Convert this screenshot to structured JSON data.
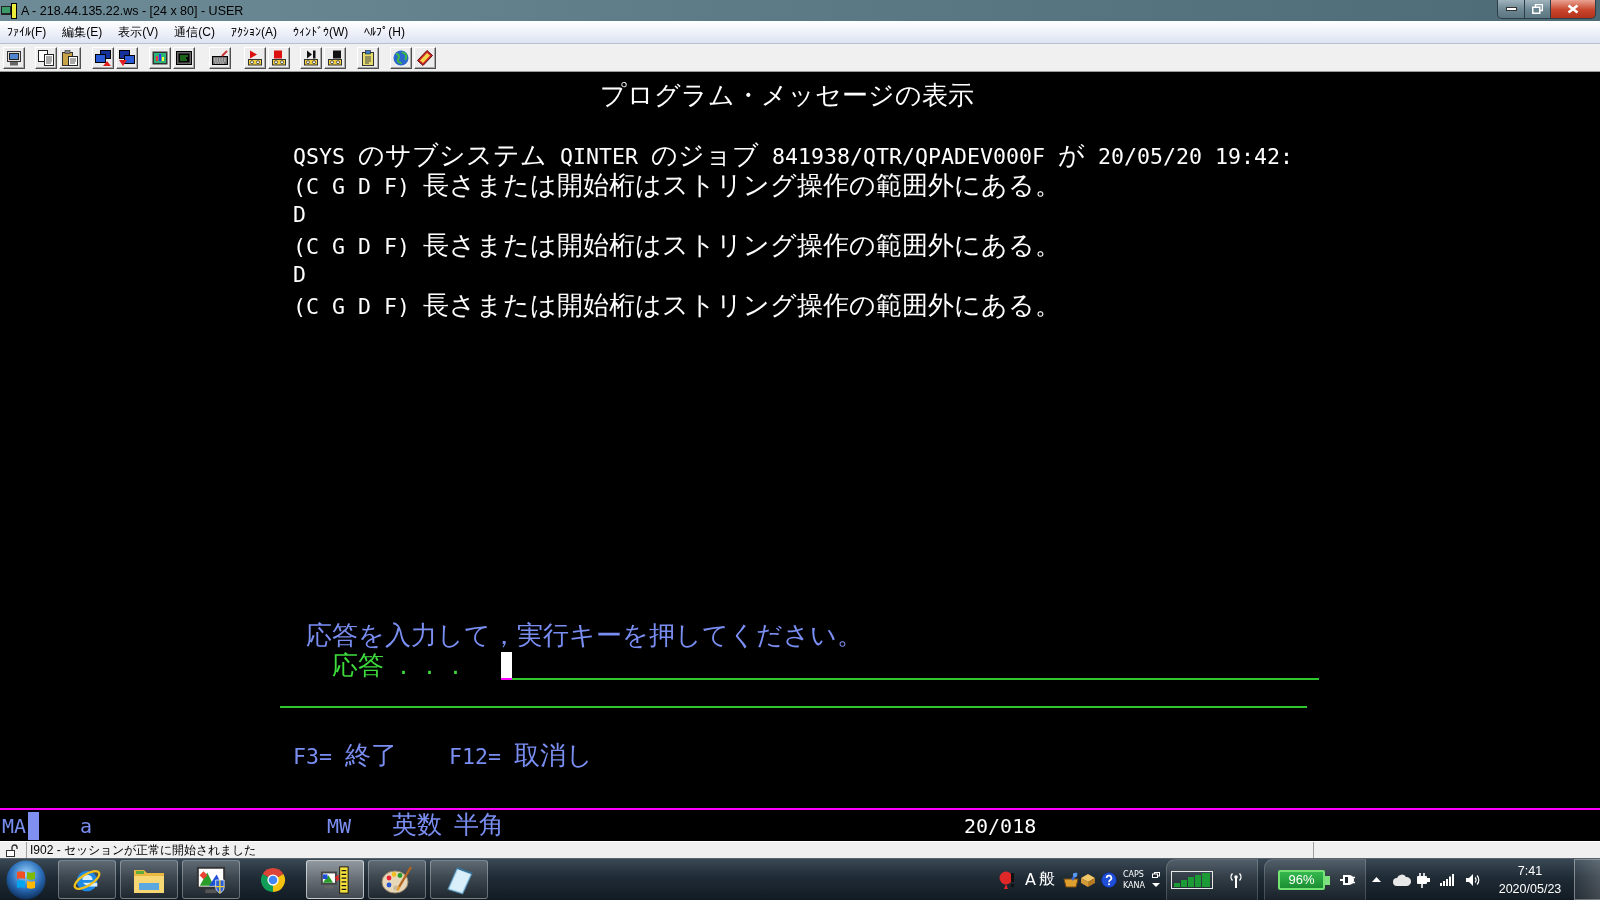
{
  "window": {
    "title": "A - 218.44.135.22.ws - [24 x 80] - USER"
  },
  "menu": [
    "ﾌｧｲﾙ(F)",
    "編集(E)",
    "表示(V)",
    "通信(C)",
    "ｱｸｼｮﾝ(A)",
    "ｳｨﾝﾄﾞｳ(W)",
    "ﾍﾙﾌﾟ(H)"
  ],
  "terminal": {
    "title": "プログラム・メッセージの表示",
    "message_lines": [
      "QSYS のサブシステム QINTER のジョブ 841938/QTR/QPADEV000F が 20/05/20 19:42:",
      "(C G D F) 長さまたは開始桁はストリング操作の範囲外にある。",
      "D",
      "(C G D F) 長さまたは開始桁はストリング操作の範囲外にある。",
      "D",
      "(C G D F) 長さまたは開始桁はストリング操作の範囲外にある。"
    ],
    "instruction": "応答を入力して，実行キーを押してください。",
    "reply_label": "応答 . . .",
    "function_keys": [
      "F3= 終了",
      "F12= 取消し"
    ]
  },
  "oia": {
    "status": "MA",
    "input_mode": "a",
    "field_mode": "MW",
    "ime_mode": "英数 半角",
    "cursor_position": "20/018"
  },
  "status_bar": {
    "message": "I902 - セッションが正常に開始されました"
  },
  "taskbar": {
    "apps": [
      {
        "kind": "orbit",
        "running": true,
        "selected": false
      },
      {
        "kind": "folder",
        "running": true,
        "selected": false
      },
      {
        "kind": "monitor",
        "running": true,
        "selected": false
      },
      {
        "kind": "circle",
        "running": false,
        "selected": false
      },
      {
        "kind": "terminal",
        "running": true,
        "selected": true
      },
      {
        "kind": "palette",
        "running": true,
        "selected": false
      },
      {
        "kind": "notepad",
        "running": true,
        "selected": false
      }
    ],
    "ime": [
      "A",
      "般"
    ],
    "keys": [
      "CAPS",
      "KANA"
    ],
    "battery": "96%",
    "time": "7:41",
    "date": "2020/05/23"
  }
}
